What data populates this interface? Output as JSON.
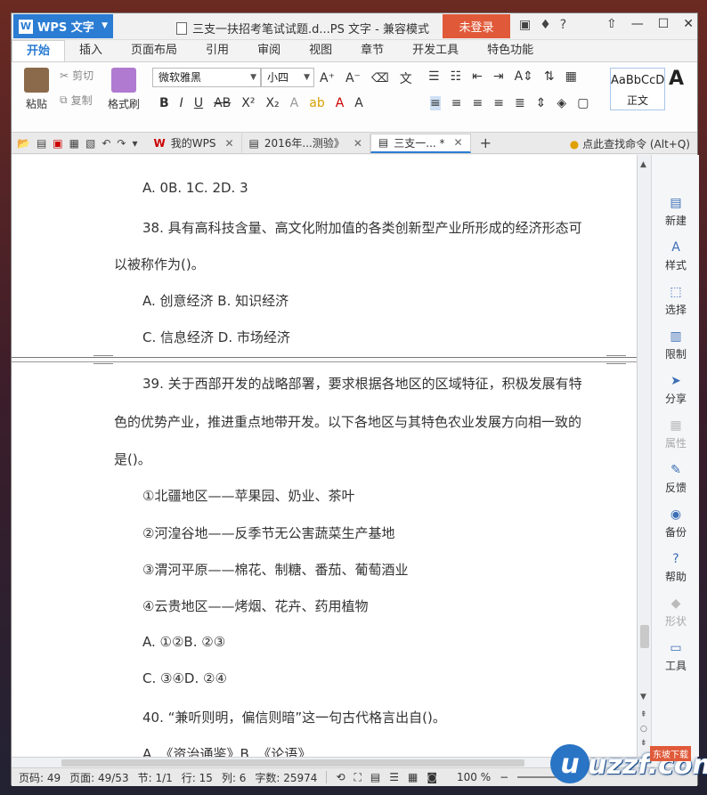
{
  "titlebar": {
    "app_name": "WPS 文字",
    "doc_title": "三支一扶招考笔试试题.d...PS 文字 - 兼容模式",
    "login": "未登录"
  },
  "tabs": [
    "开始",
    "插入",
    "页面布局",
    "引用",
    "审阅",
    "视图",
    "章节",
    "开发工具",
    "特色功能"
  ],
  "ribbon": {
    "paste": "粘贴",
    "cut": "剪切",
    "copy": "复制",
    "format_painter": "格式刷",
    "font_name": "微软雅黑",
    "font_size": "小四",
    "style_sample": "AaBbCcD",
    "style_name": "正文",
    "style_big": "A"
  },
  "doctabs": {
    "tabs": [
      {
        "label": "我的WPS"
      },
      {
        "label": "2016年...测验》"
      },
      {
        "label": "三支一... *"
      }
    ],
    "find": "点此查找命令 (Alt+Q)"
  },
  "document": {
    "top_lines": [
      "A. 0B. 1C. 2D. 3",
      "38. 具有高科技含量、高文化附加值的各类创新型产业所形成的经济形态可",
      "以被称作为()。",
      "A. 创意经济 B. 知识经济",
      "C. 信息经济 D. 市场经济"
    ],
    "bottom_lines": [
      "39. 关于西部开发的战略部署，要求根据各地区的区域特征，积极发展有特",
      "色的优势产业，推进重点地带开发。以下各地区与其特色农业发展方向相一致的",
      "是()。",
      "①北疆地区——苹果园、奶业、茶叶",
      "②河湟谷地——反季节无公害蔬菜生产基地",
      "③渭河平原——棉花、制糖、番茄、葡萄酒业",
      "④云贵地区——烤烟、花卉、药用植物",
      "A. ①②B. ②③",
      "C. ③④D. ②④",
      "40. “兼听则明，偏信则暗”这一句古代格言出自()。",
      "A. 《资治通鉴》B. 《论语》"
    ]
  },
  "sidepanel": [
    {
      "label": "新建",
      "icon": "new-doc-icon",
      "enabled": true
    },
    {
      "label": "样式",
      "icon": "style-icon",
      "enabled": true
    },
    {
      "label": "选择",
      "icon": "select-icon",
      "enabled": true
    },
    {
      "label": "限制",
      "icon": "lock-doc-icon",
      "enabled": true
    },
    {
      "label": "分享",
      "icon": "share-icon",
      "enabled": true
    },
    {
      "label": "属性",
      "icon": "properties-icon",
      "enabled": false
    },
    {
      "label": "反馈",
      "icon": "feedback-icon",
      "enabled": true
    },
    {
      "label": "备份",
      "icon": "backup-icon",
      "enabled": true
    },
    {
      "label": "帮助",
      "icon": "help-icon",
      "enabled": true
    },
    {
      "label": "形状",
      "icon": "shapes-icon",
      "enabled": false
    },
    {
      "label": "工具",
      "icon": "toolbox-icon",
      "enabled": true
    }
  ],
  "status": {
    "page_num": "页码: 49",
    "page": "页面: 49/53",
    "section": "节: 1/1",
    "row": "行: 15",
    "col": "列: 6",
    "words": "字数: 25974",
    "zoom": "100 %"
  },
  "watermark": {
    "text": "uzzf.com",
    "u": "u",
    "tag": "东坡下载"
  }
}
